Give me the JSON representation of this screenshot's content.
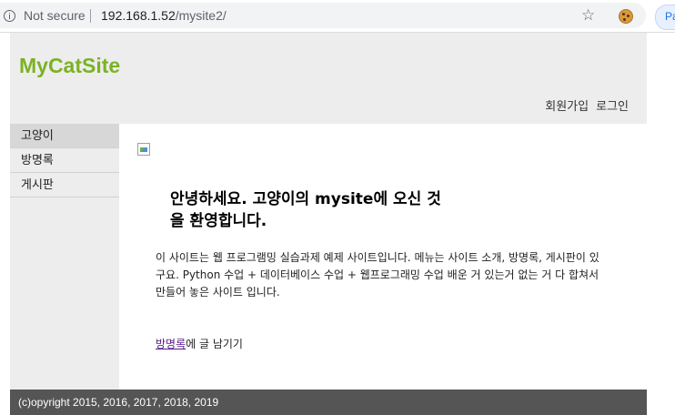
{
  "browser": {
    "security_label": "Not secure",
    "url_host": "192.168.1.52",
    "url_path": "/mysite2/",
    "profile_label": "Pa"
  },
  "header": {
    "logo": "MyCatSite",
    "nav": {
      "join": "회원가입",
      "login": "로그인"
    }
  },
  "sidebar": {
    "items": [
      {
        "label": "고양이",
        "active": true
      },
      {
        "label": "방명록",
        "active": false
      },
      {
        "label": "게시판",
        "active": false
      }
    ]
  },
  "main": {
    "headline": "안녕하세요. 고양이의 mysite에 오신 것을 환영합니다.",
    "description": "이 사이트는 웹 프로그램밍 실습과제 예제 사이트입니다. 메뉴는 사이트 소개, 방명록, 게시판이 있구요. Python 수업 + 데이터베이스 수업 + 웹프로그래밍 수업 배운 거 있는거 없는 거 다 합쳐서 만들어 놓은 사이트 입니다.",
    "guestbook_link": "방명록",
    "guestbook_suffix": "에 글 남기기"
  },
  "footer": {
    "copyright": "(c)opyright 2015, 2016, 2017, 2018, 2019"
  },
  "colors": {
    "logo": "#7cb224",
    "header_bg": "#ededed",
    "footer_bg": "#555555",
    "link_visited": "#551a8b"
  }
}
